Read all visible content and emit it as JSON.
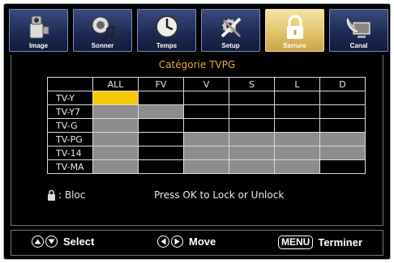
{
  "tabs": [
    {
      "label": "Image",
      "icon": "video-camera-icon",
      "active": false
    },
    {
      "label": "Sonner",
      "icon": "speaker-music-icon",
      "active": false
    },
    {
      "label": "Temps",
      "icon": "clock-icon",
      "active": false
    },
    {
      "label": "Setup",
      "icon": "tools-icon",
      "active": false
    },
    {
      "label": "Serrure",
      "icon": "lock-icon",
      "active": true
    },
    {
      "label": "Canal",
      "icon": "satellite-dish-tv-icon",
      "active": false
    }
  ],
  "panel": {
    "title": "Catégorie TVPG",
    "columns": [
      "ALL",
      "FV",
      "V",
      "S",
      "L",
      "D"
    ],
    "rows": [
      {
        "label": "TV-Y",
        "cells": [
          "yellow",
          "black",
          "black",
          "black",
          "black",
          "black"
        ]
      },
      {
        "label": "TV-Y7",
        "cells": [
          "gray",
          "gray",
          "black",
          "black",
          "black",
          "black"
        ]
      },
      {
        "label": "TV-G",
        "cells": [
          "gray",
          "black",
          "black",
          "black",
          "black",
          "black"
        ]
      },
      {
        "label": "TV-PG",
        "cells": [
          "gray",
          "black",
          "gray",
          "gray",
          "gray",
          "gray"
        ]
      },
      {
        "label": "TV-14",
        "cells": [
          "gray",
          "black",
          "gray",
          "gray",
          "gray",
          "gray"
        ]
      },
      {
        "label": "TV-MA",
        "cells": [
          "gray",
          "black",
          "gray",
          "gray",
          "gray",
          "black"
        ]
      }
    ],
    "legend_label": ": Bloc",
    "hint": "Press OK to Lock or Unlock"
  },
  "footer": {
    "select_label": "Select",
    "move_label": "Move",
    "menu_key": "MENU",
    "exit_label": "Terminer"
  },
  "colors": {
    "accent_title": "#e3a93a",
    "cursor": "#f6c800",
    "locked": "#8d8d8d",
    "active_tab": "#e2c46c"
  }
}
